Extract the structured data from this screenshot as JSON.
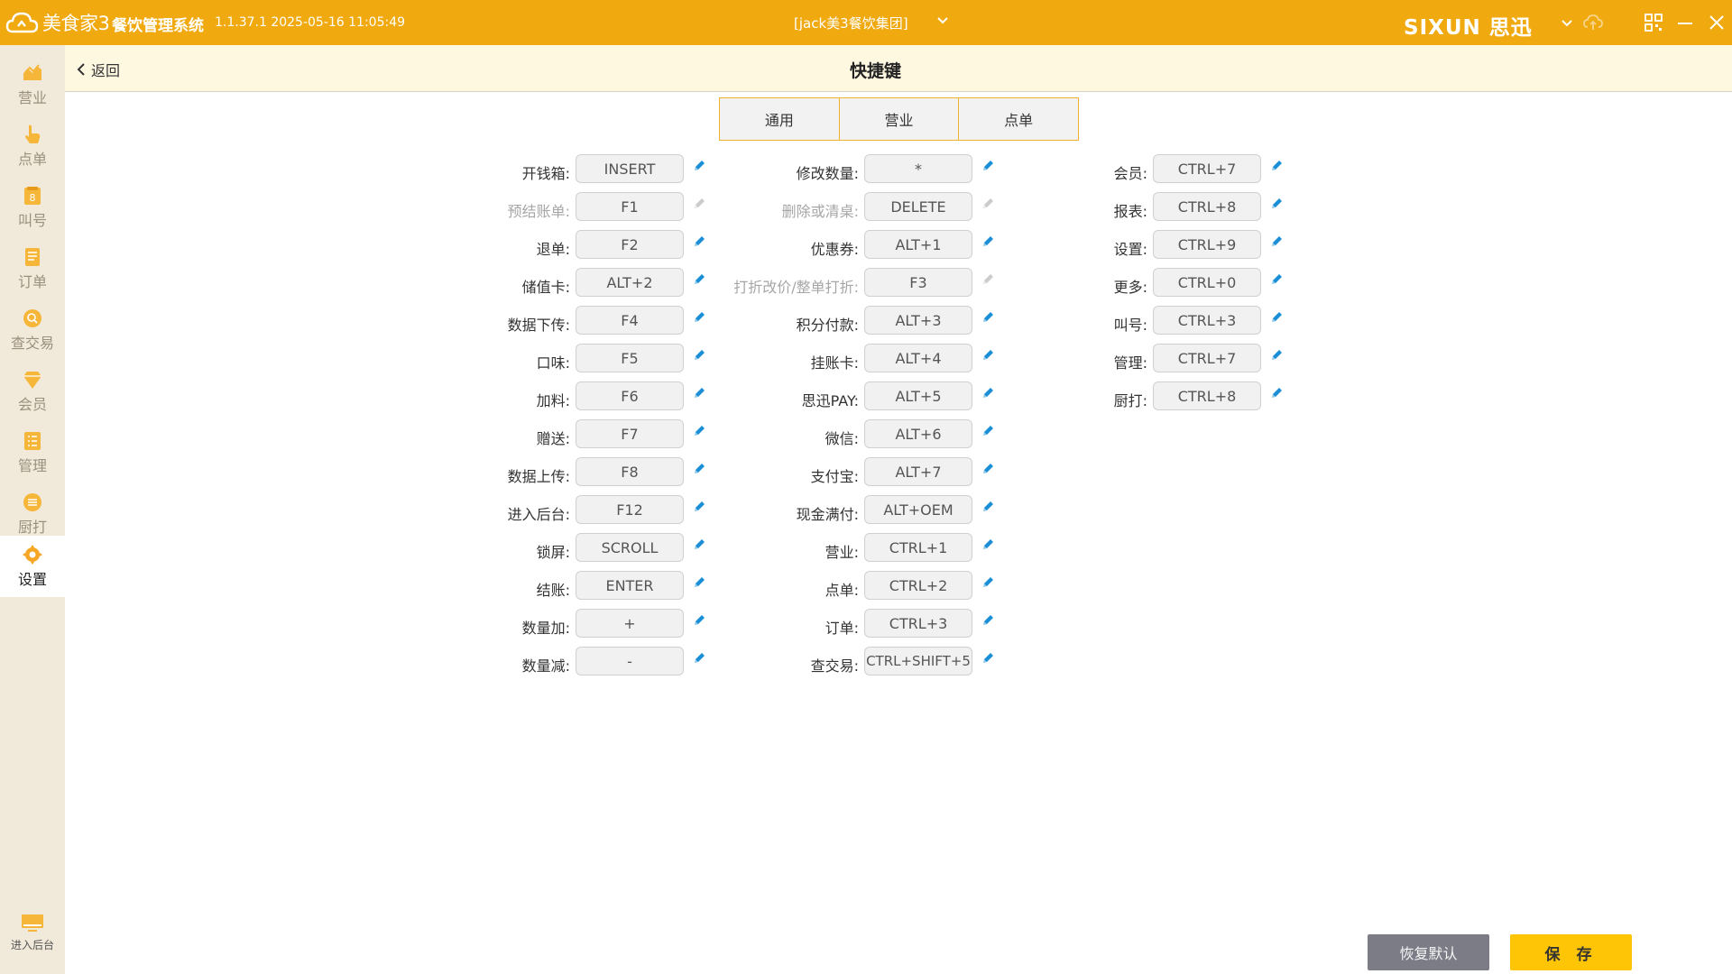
{
  "titlebar": {
    "app_name": "美食家3",
    "system_title": "餐饮管理系统",
    "version": "1.1.37.1 2025-05-16 11:05:49",
    "group_name": "[jack美3餐饮集团]",
    "brand": "SIXUN 思迅"
  },
  "sidebar": {
    "items": [
      {
        "label": "营业",
        "icon": "business-icon"
      },
      {
        "label": "点单",
        "icon": "order-hand-icon"
      },
      {
        "label": "叫号",
        "icon": "call-number-icon"
      },
      {
        "label": "订单",
        "icon": "orders-icon"
      },
      {
        "label": "查交易",
        "icon": "search-trade-icon"
      },
      {
        "label": "会员",
        "icon": "member-diamond-icon"
      },
      {
        "label": "管理",
        "icon": "management-icon"
      },
      {
        "label": "厨打",
        "icon": "kitchen-print-icon"
      },
      {
        "label": "设置",
        "icon": "settings-gear-icon"
      }
    ],
    "active_item": "设置",
    "bottom_label": "进入后台"
  },
  "header": {
    "back_label": "返回",
    "page_title": "快捷键"
  },
  "tabs": [
    {
      "label": "通用"
    },
    {
      "label": "营业"
    },
    {
      "label": "点单"
    }
  ],
  "shortcuts": {
    "col1": [
      {
        "label": "开钱箱:",
        "key": "INSERT",
        "disabled": false
      },
      {
        "label": "预结账单:",
        "key": "F1",
        "disabled": true
      },
      {
        "label": "退单:",
        "key": "F2",
        "disabled": false
      },
      {
        "label": "储值卡:",
        "key": "ALT+2",
        "disabled": false
      },
      {
        "label": "数据下传:",
        "key": "F4",
        "disabled": false
      },
      {
        "label": "口味:",
        "key": "F5",
        "disabled": false
      },
      {
        "label": "加料:",
        "key": "F6",
        "disabled": false
      },
      {
        "label": "赠送:",
        "key": "F7",
        "disabled": false
      },
      {
        "label": "数据上传:",
        "key": "F8",
        "disabled": false
      },
      {
        "label": "进入后台:",
        "key": "F12",
        "disabled": false
      },
      {
        "label": "锁屏:",
        "key": "SCROLL",
        "disabled": false
      },
      {
        "label": "结账:",
        "key": "ENTER",
        "disabled": false
      },
      {
        "label": "数量加:",
        "key": "+",
        "disabled": false
      },
      {
        "label": "数量减:",
        "key": "-",
        "disabled": false
      }
    ],
    "col2": [
      {
        "label": "修改数量:",
        "key": "*",
        "disabled": false
      },
      {
        "label": "删除或清桌:",
        "key": "DELETE",
        "disabled": true
      },
      {
        "label": "优惠券:",
        "key": "ALT+1",
        "disabled": false
      },
      {
        "label": "打折改价/整单打折:",
        "key": "F3",
        "disabled": true
      },
      {
        "label": "积分付款:",
        "key": "ALT+3",
        "disabled": false
      },
      {
        "label": "挂账卡:",
        "key": "ALT+4",
        "disabled": false
      },
      {
        "label": "思迅PAY:",
        "key": "ALT+5",
        "disabled": false
      },
      {
        "label": "微信:",
        "key": "ALT+6",
        "disabled": false
      },
      {
        "label": "支付宝:",
        "key": "ALT+7",
        "disabled": false
      },
      {
        "label": "现金满付:",
        "key": "ALT+OEM",
        "disabled": false
      },
      {
        "label": "营业:",
        "key": "CTRL+1",
        "disabled": false
      },
      {
        "label": "点单:",
        "key": "CTRL+2",
        "disabled": false
      },
      {
        "label": "订单:",
        "key": "CTRL+3",
        "disabled": false
      },
      {
        "label": "查交易:",
        "key": "CTRL+SHIFT+5",
        "disabled": false
      }
    ],
    "col3": [
      {
        "label": "会员:",
        "key": "CTRL+7",
        "disabled": false
      },
      {
        "label": "报表:",
        "key": "CTRL+8",
        "disabled": false
      },
      {
        "label": "设置:",
        "key": "CTRL+9",
        "disabled": false
      },
      {
        "label": "更多:",
        "key": "CTRL+0",
        "disabled": false
      },
      {
        "label": "叫号:",
        "key": "CTRL+3",
        "disabled": false
      },
      {
        "label": "管理:",
        "key": "CTRL+7",
        "disabled": false
      },
      {
        "label": "厨打:",
        "key": "CTRL+8",
        "disabled": false
      }
    ]
  },
  "footer": {
    "reset_label": "恢复默认",
    "save_label": "保 存"
  },
  "colors": {
    "titlebar": "#f0a90f",
    "sidebar": "#f1eada",
    "accent": "#f5a623",
    "pen_enabled": "#1a8fd6",
    "pen_disabled": "#cccccc",
    "save_button": "#fec506",
    "reset_button": "#7c7c86"
  }
}
